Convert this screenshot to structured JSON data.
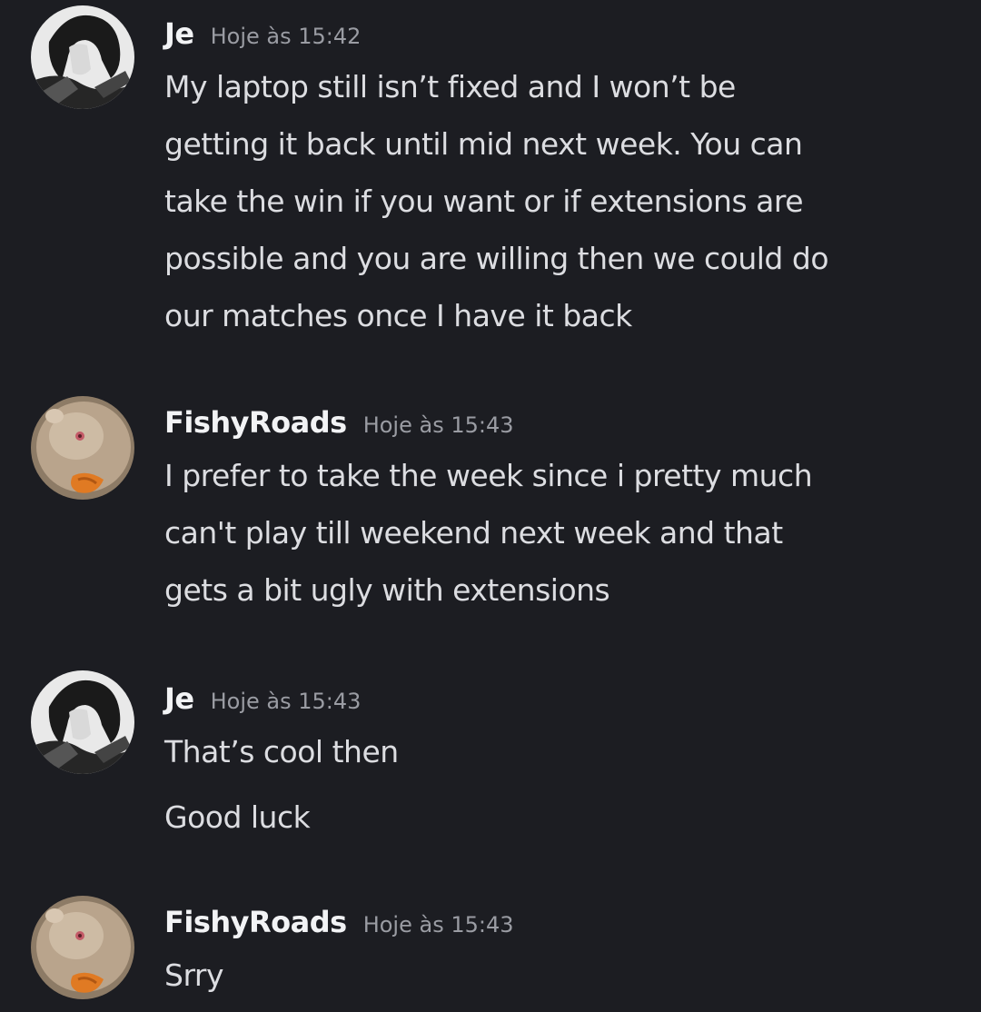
{
  "messages": [
    {
      "author": "Je",
      "time": "Hoje às 15:42",
      "avatar_icon": "anime-character-avatar-icon",
      "lines": [
        "My laptop still isn’t fixed and I won’t be",
        "getting it back until mid next week. You can",
        "take the win if you want or if extensions are",
        "possible and you are willing then we could do",
        "our matches once I have it back"
      ]
    },
    {
      "author": "FishyRoads",
      "time": "Hoje às 15:43",
      "avatar_icon": "hamster-avatar-icon",
      "lines": [
        "I prefer to take the week since i pretty much",
        "can't play till weekend next week and that",
        "gets a bit ugly with extensions"
      ]
    },
    {
      "author": "Je",
      "time": "Hoje às 15:43",
      "avatar_icon": "anime-character-avatar-icon",
      "lines": [
        "That’s cool then",
        "Good luck"
      ]
    },
    {
      "author": "FishyRoads",
      "time": "Hoje às 15:43",
      "avatar_icon": "hamster-avatar-icon",
      "lines": [
        "Srry"
      ]
    }
  ],
  "colors": {
    "background": "#1c1d22",
    "username": "#f2f3f5",
    "timestamp": "#9a9ca3",
    "text": "#dcdde1"
  }
}
